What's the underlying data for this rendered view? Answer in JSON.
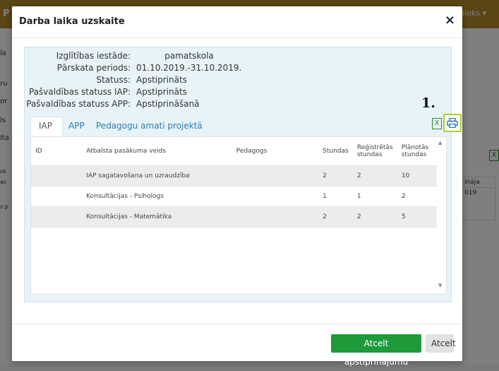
{
  "background": {
    "brand": "P",
    "user_menu": "rbinieks ▾",
    "left_fragments": [
      "la",
      "ru",
      "or",
      "ls",
      "ita",
      "sk",
      "as",
      "s p"
    ],
    "table_header": "ināja",
    "table_cell": "019"
  },
  "modal": {
    "title": "Darba laika uzskaite",
    "close_symbol": "×"
  },
  "info": [
    {
      "label": "Izglītības iestāde:",
      "value": "pamatskola"
    },
    {
      "label": "Pārskata periods:",
      "value": "01.10.2019.-31.10.2019."
    },
    {
      "label": "Statuss:",
      "value": "Apstiprināts"
    },
    {
      "label": "Pašvaldības statuss IAP:",
      "value": "Apstiprināts"
    },
    {
      "label": "Pašvaldības statuss APP:",
      "value": "Apstiprināšanā"
    }
  ],
  "annotation": {
    "step": "1."
  },
  "tabs": [
    {
      "label": "IAP",
      "active": true
    },
    {
      "label": "APP",
      "active": false
    },
    {
      "label": "Pedagogu amati projektā",
      "active": false
    }
  ],
  "table": {
    "headers": [
      "ID",
      "Atbalsta pasākuma veids",
      "Pedagogs",
      "Stundas",
      "Reģistrētās stundas",
      "Plānotās stundas"
    ],
    "rows": [
      [
        "",
        "IAP sagatavošana un uzraudzība",
        "",
        "2",
        "2",
        "10"
      ],
      [
        "",
        "Konsultācijas - Psihologs",
        "",
        "1",
        "1",
        "2"
      ],
      [
        "",
        "Konsultācijas - Matemātika",
        "",
        "2",
        "2",
        "5"
      ]
    ]
  },
  "buttons": {
    "primary": "Atcelt apstiprinājumu",
    "secondary": "Atcelt"
  },
  "icons": {
    "excel": "excel-export-icon",
    "print": "print-icon",
    "colors": {
      "excel": "#2a8a2a",
      "print_highlight": "#a8d22a",
      "primary_button": "#1f9a3a",
      "tab_link": "#2b7bb9"
    }
  }
}
